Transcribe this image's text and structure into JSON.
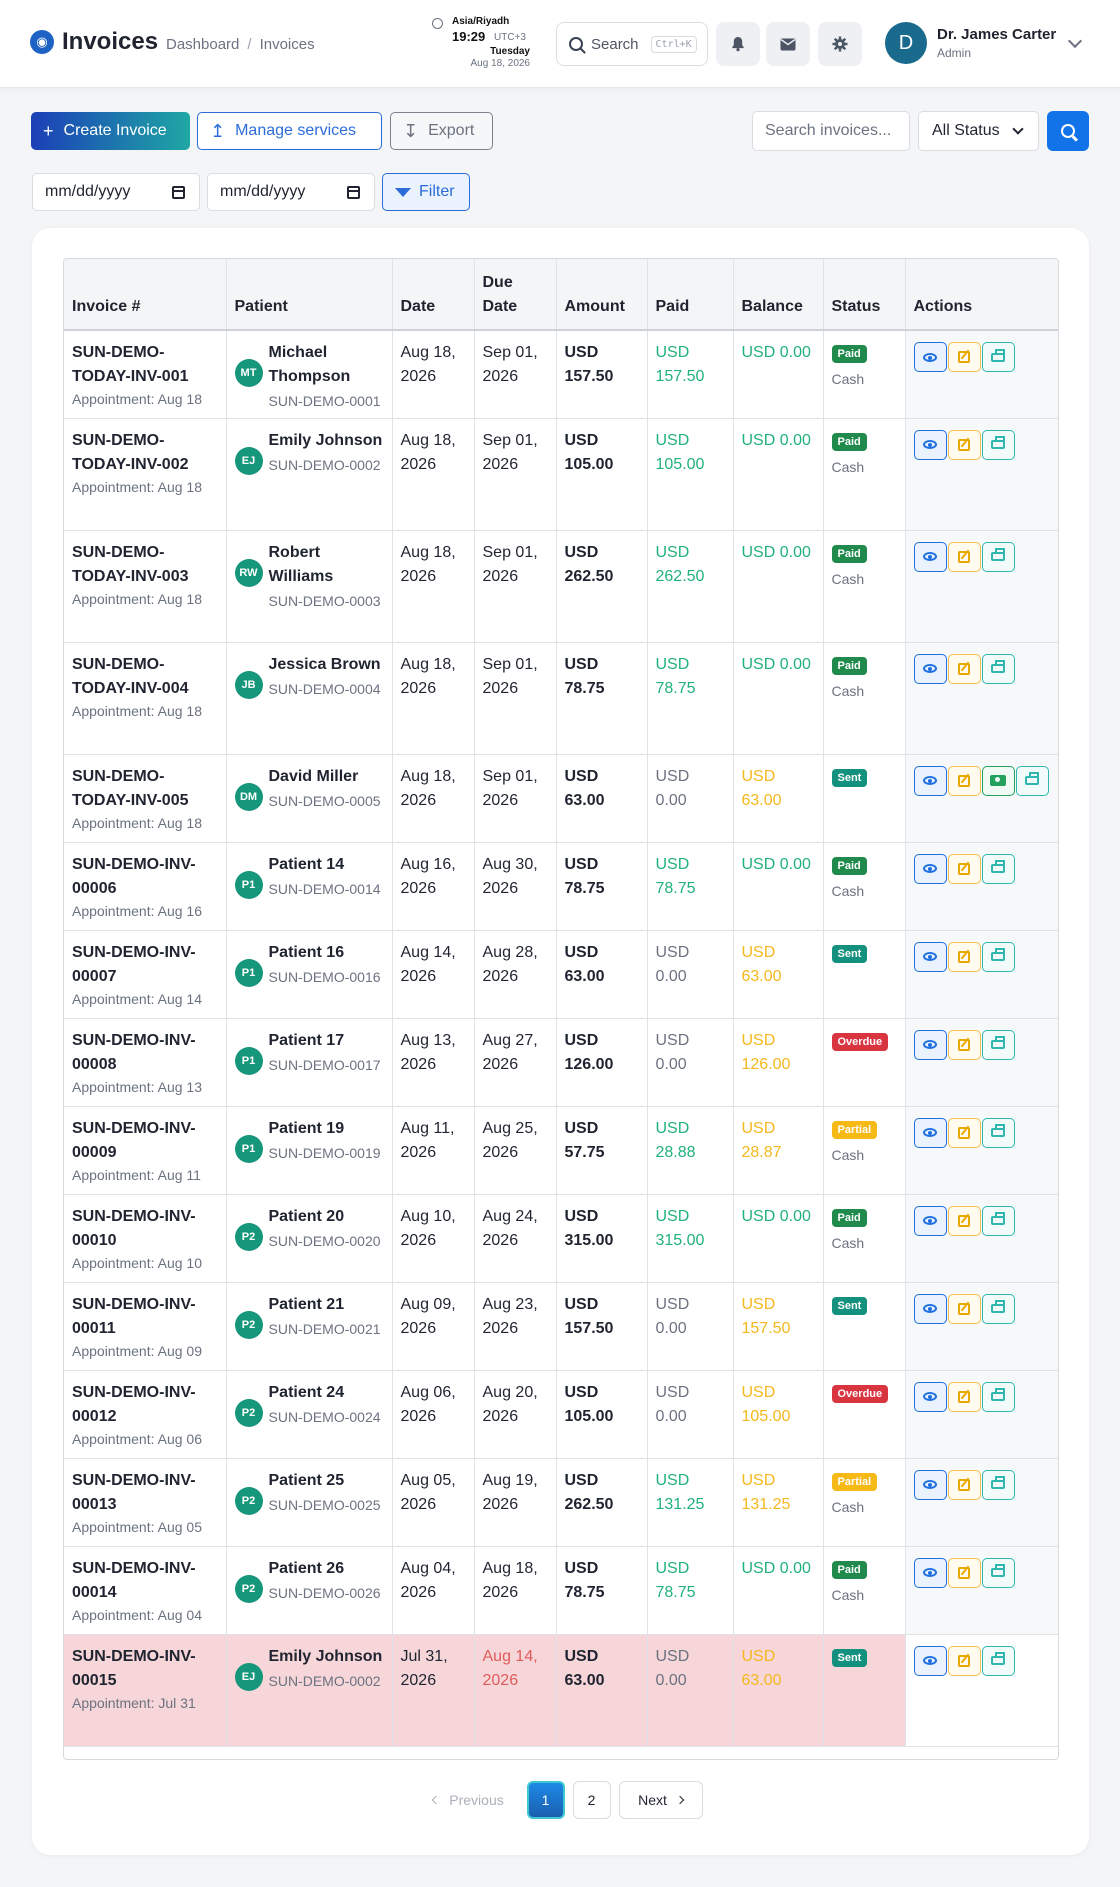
{
  "header": {
    "app_title": "Invoices",
    "breadcrumb": [
      "Dashboard",
      "Invoices"
    ],
    "clock": {
      "timezone": "Asia/Riyadh",
      "time": "19:29",
      "utc": "UTC+3",
      "day": "Tuesday",
      "date": "Aug 18, 2026"
    },
    "search_label": "Search",
    "search_shortcut": "Ctrl+K",
    "user": {
      "initial": "D",
      "name": "Dr. James Carter",
      "role": "Admin"
    }
  },
  "toolbar": {
    "create_label": "Create Invoice",
    "manage_label": "Manage services",
    "export_label": "Export",
    "search_placeholder": "Search invoices...",
    "status_selected": "All Status",
    "date_from_placeholder": "mm/dd/yyyy",
    "date_to_placeholder": "mm/dd/yyyy",
    "filter_label": "Filter"
  },
  "table": {
    "columns": [
      "Invoice #",
      "Patient",
      "Date",
      "Due Date",
      "Amount",
      "Paid",
      "Balance",
      "Status",
      "Actions"
    ],
    "rows": [
      {
        "inv": "SUN-DEMO-TODAY-INV-001",
        "appt": "Appointment: Aug 18",
        "initials": "MT",
        "patient": "Michael Thompson",
        "code": "SUN-DEMO-0001",
        "date": "Aug 18, 2026",
        "due": "Sep 01, 2026",
        "amount": "USD 157.50",
        "paid": "USD 157.50",
        "balance": "USD 0.00",
        "status": "Paid",
        "method": "Cash"
      },
      {
        "inv": "SUN-DEMO-TODAY-INV-002",
        "appt": "Appointment: Aug 18",
        "initials": "EJ",
        "patient": "Emily Johnson",
        "code": "SUN-DEMO-0002",
        "date": "Aug 18, 2026",
        "due": "Sep 01, 2026",
        "amount": "USD 105.00",
        "paid": "USD 105.00",
        "balance": "USD 0.00",
        "status": "Paid",
        "method": "Cash"
      },
      {
        "inv": "SUN-DEMO-TODAY-INV-003",
        "appt": "Appointment: Aug 18",
        "initials": "RW",
        "patient": "Robert Williams",
        "code": "SUN-DEMO-0003",
        "date": "Aug 18, 2026",
        "due": "Sep 01, 2026",
        "amount": "USD 262.50",
        "paid": "USD 262.50",
        "balance": "USD 0.00",
        "status": "Paid",
        "method": "Cash"
      },
      {
        "inv": "SUN-DEMO-TODAY-INV-004",
        "appt": "Appointment: Aug 18",
        "initials": "JB",
        "patient": "Jessica Brown",
        "code": "SUN-DEMO-0004",
        "date": "Aug 18, 2026",
        "due": "Sep 01, 2026",
        "amount": "USD 78.75",
        "paid": "USD 78.75",
        "balance": "USD 0.00",
        "status": "Paid",
        "method": "Cash"
      },
      {
        "inv": "SUN-DEMO-TODAY-INV-005",
        "appt": "Appointment: Aug 18",
        "initials": "DM",
        "patient": "David Miller",
        "code": "SUN-DEMO-0005",
        "date": "Aug 18, 2026",
        "due": "Sep 01, 2026",
        "amount": "USD 63.00",
        "paid": "USD 0.00",
        "balance": "USD 63.00",
        "status": "Sent",
        "method": ""
      },
      {
        "inv": "SUN-DEMO-INV-00006",
        "appt": "Appointment: Aug 16",
        "initials": "P1",
        "patient": "Patient 14",
        "code": "SUN-DEMO-0014",
        "date": "Aug 16, 2026",
        "due": "Aug 30, 2026",
        "amount": "USD 78.75",
        "paid": "USD 78.75",
        "balance": "USD 0.00",
        "status": "Paid",
        "method": "Cash"
      },
      {
        "inv": "SUN-DEMO-INV-00007",
        "appt": "Appointment: Aug 14",
        "initials": "P1",
        "patient": "Patient 16",
        "code": "SUN-DEMO-0016",
        "date": "Aug 14, 2026",
        "due": "Aug 28, 2026",
        "amount": "USD 63.00",
        "paid": "USD 0.00",
        "balance": "USD 63.00",
        "status": "Sent",
        "method": ""
      },
      {
        "inv": "SUN-DEMO-INV-00008",
        "appt": "Appointment: Aug 13",
        "initials": "P1",
        "patient": "Patient 17",
        "code": "SUN-DEMO-0017",
        "date": "Aug 13, 2026",
        "due": "Aug 27, 2026",
        "amount": "USD 126.00",
        "paid": "USD 0.00",
        "balance": "USD 126.00",
        "status": "Overdue",
        "method": ""
      },
      {
        "inv": "SUN-DEMO-INV-00009",
        "appt": "Appointment: Aug 11",
        "initials": "P1",
        "patient": "Patient 19",
        "code": "SUN-DEMO-0019",
        "date": "Aug 11, 2026",
        "due": "Aug 25, 2026",
        "amount": "USD 57.75",
        "paid": "USD 28.88",
        "balance": "USD 28.87",
        "status": "Partial",
        "method": "Cash"
      },
      {
        "inv": "SUN-DEMO-INV-00010",
        "appt": "Appointment: Aug 10",
        "initials": "P2",
        "patient": "Patient 20",
        "code": "SUN-DEMO-0020",
        "date": "Aug 10, 2026",
        "due": "Aug 24, 2026",
        "amount": "USD 315.00",
        "paid": "USD 315.00",
        "balance": "USD 0.00",
        "status": "Paid",
        "method": "Cash"
      },
      {
        "inv": "SUN-DEMO-INV-00011",
        "appt": "Appointment: Aug 09",
        "initials": "P2",
        "patient": "Patient 21",
        "code": "SUN-DEMO-0021",
        "date": "Aug 09, 2026",
        "due": "Aug 23, 2026",
        "amount": "USD 157.50",
        "paid": "USD 0.00",
        "balance": "USD 157.50",
        "status": "Sent",
        "method": ""
      },
      {
        "inv": "SUN-DEMO-INV-00012",
        "appt": "Appointment: Aug 06",
        "initials": "P2",
        "patient": "Patient 24",
        "code": "SUN-DEMO-0024",
        "date": "Aug 06, 2026",
        "due": "Aug 20, 2026",
        "amount": "USD 105.00",
        "paid": "USD 0.00",
        "balance": "USD 105.00",
        "status": "Overdue",
        "method": ""
      },
      {
        "inv": "SUN-DEMO-INV-00013",
        "appt": "Appointment: Aug 05",
        "initials": "P2",
        "patient": "Patient 25",
        "code": "SUN-DEMO-0025",
        "date": "Aug 05, 2026",
        "due": "Aug 19, 2026",
        "amount": "USD 262.50",
        "paid": "USD 131.25",
        "balance": "USD 131.25",
        "status": "Partial",
        "method": "Cash"
      },
      {
        "inv": "SUN-DEMO-INV-00014",
        "appt": "Appointment: Aug 04",
        "initials": "P2",
        "patient": "Patient 26",
        "code": "SUN-DEMO-0026",
        "date": "Aug 04, 2026",
        "due": "Aug 18, 2026",
        "amount": "USD 78.75",
        "paid": "USD 78.75",
        "balance": "USD 0.00",
        "status": "Paid",
        "method": "Cash"
      },
      {
        "inv": "SUN-DEMO-INV-00015",
        "appt": "Appointment: Jul 31",
        "initials": "EJ",
        "patient": "Emily Johnson",
        "code": "SUN-DEMO-0002",
        "date": "Jul 31, 2026",
        "due": "Aug 14, 2026",
        "amount": "USD 63.00",
        "paid": "USD 0.00",
        "balance": "USD 63.00",
        "status": "Sent",
        "method": "",
        "highlight": "overdue"
      }
    ]
  },
  "pagination": {
    "previous": "Previous",
    "pages": [
      "1",
      "2"
    ],
    "current": "1",
    "next": "Next"
  }
}
